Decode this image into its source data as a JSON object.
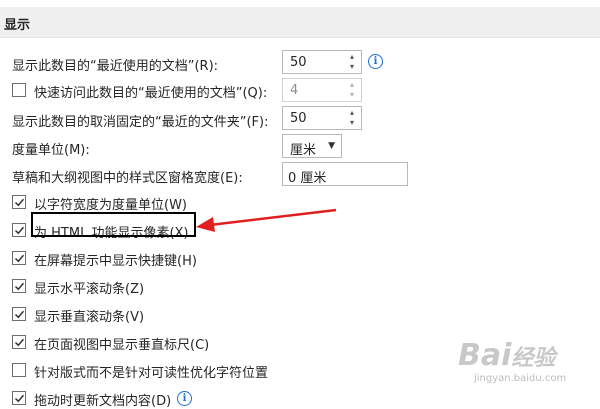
{
  "section": {
    "title": "显示"
  },
  "rows": {
    "recent_docs": {
      "label": "显示此数目的“最近使用的文档”(R):",
      "value": "50"
    },
    "quick_access": {
      "label": "快速访问此数目的“最近使用的文档”(Q):",
      "value": "4",
      "checked": false
    },
    "unpinned_folders": {
      "label": "显示此数目的取消固定的“最近的文件夹”(F):",
      "value": "50"
    },
    "unit": {
      "label": "度量单位(M):",
      "value": "厘米"
    },
    "draft_width": {
      "label": "草稿和大纲视图中的样式区窗格宽度(E):",
      "value": "0 厘米"
    }
  },
  "checkboxes": [
    {
      "label": "以字符宽度为度量单位(W)",
      "checked": true
    },
    {
      "label": "为 HTML 功能显示像素(X)",
      "checked": true
    },
    {
      "label": "在屏幕提示中显示快捷键(H)",
      "checked": true
    },
    {
      "label": "显示水平滚动条(Z)",
      "checked": true
    },
    {
      "label": "显示垂直滚动条(V)",
      "checked": true
    },
    {
      "label": "在页面视图中显示垂直标尺(C)",
      "checked": true
    },
    {
      "label": "针对版式而不是针对可读性优化字符位置",
      "checked": false
    },
    {
      "label": "拖动时更新文档内容(D)",
      "checked": true
    }
  ],
  "icons": {
    "info": "info-icon",
    "spin_up": "▴",
    "spin_down": "▾",
    "caret": "▼"
  },
  "colors": {
    "accent": "#1f6fd1",
    "annotation_arrow": "#e02020"
  },
  "watermark": {
    "brand": "Bai",
    "brand2": "经验",
    "url": "jingyan.baidu.com"
  }
}
